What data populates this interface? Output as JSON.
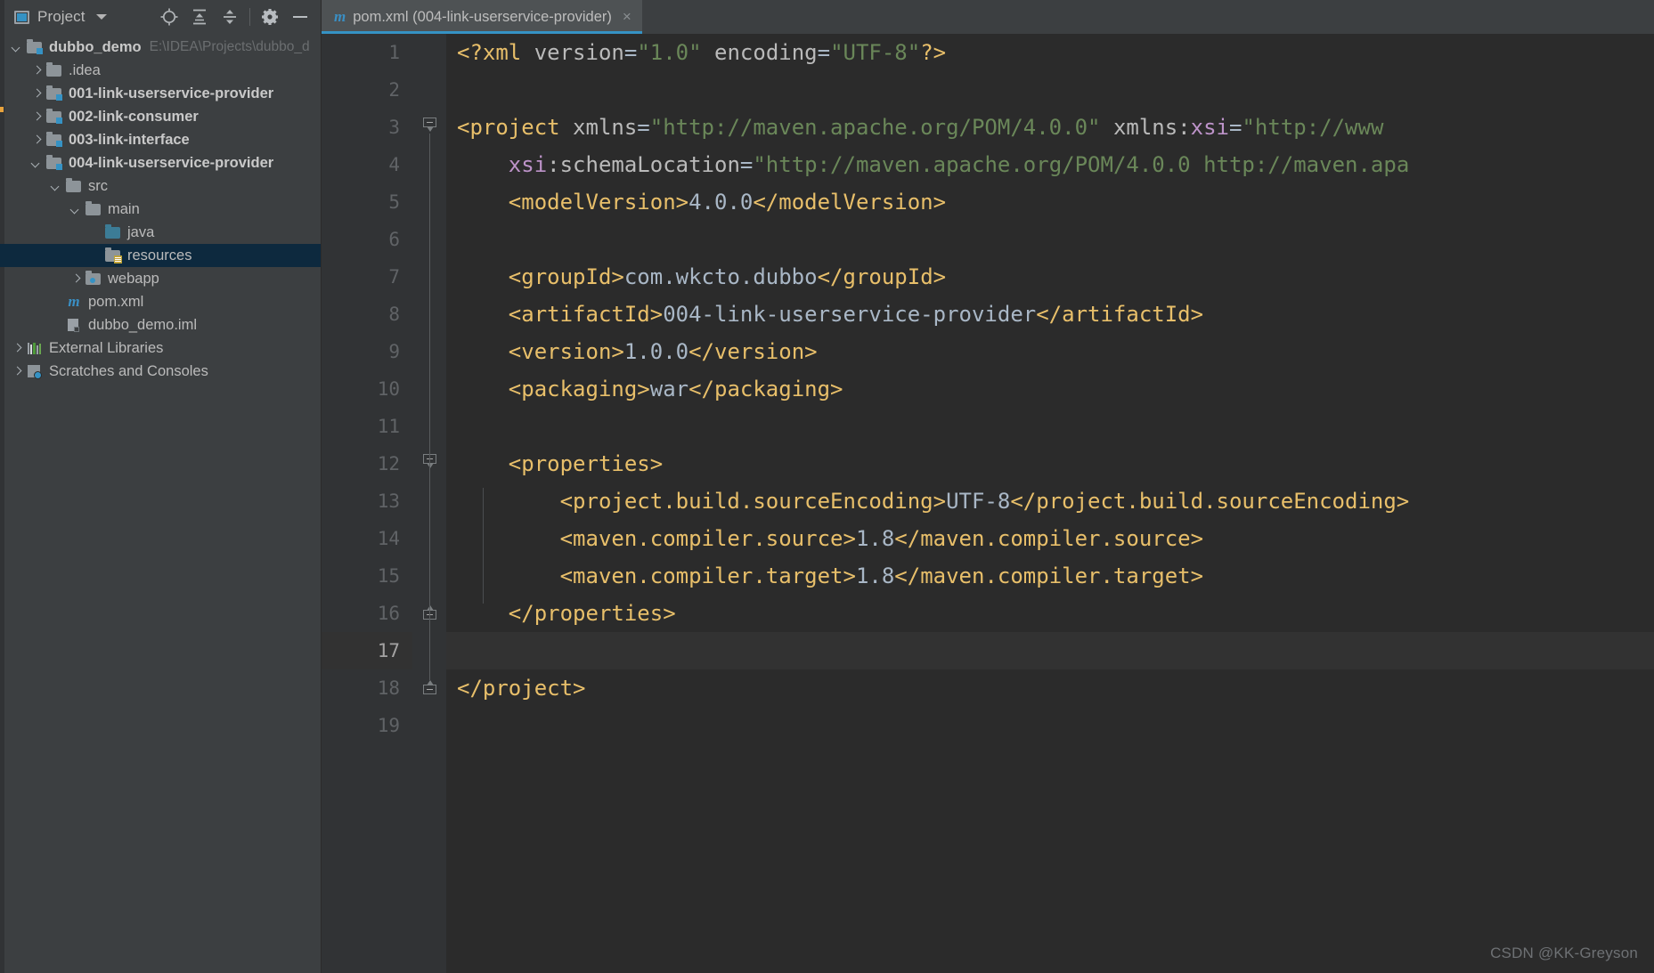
{
  "sidebar": {
    "title": "Project",
    "title_icon": "project-panel-icon",
    "caret_icon": "chevron-down-icon",
    "toolbar_buttons": [
      {
        "name": "locate-icon",
        "tooltip": "Select Opened File"
      },
      {
        "name": "expand-all-icon",
        "tooltip": "Expand All"
      },
      {
        "name": "collapse-all-icon",
        "tooltip": "Collapse All"
      },
      {
        "name": "gear-icon",
        "tooltip": "Settings"
      },
      {
        "name": "minimize-icon",
        "tooltip": "Hide"
      }
    ],
    "tree": [
      {
        "label": "dubbo_demo",
        "sub": "E:\\IDEA\\Projects\\dubbo_d",
        "indent": 0,
        "arrow": "down",
        "icon": "module-folder-icon",
        "bold": true,
        "selected": false
      },
      {
        "label": ".idea",
        "sub": "",
        "indent": 1,
        "arrow": "right",
        "icon": "folder-icon",
        "bold": false,
        "selected": false
      },
      {
        "label": "001-link-userservice-provider",
        "sub": "",
        "indent": 1,
        "arrow": "right",
        "icon": "module-folder-icon",
        "bold": true,
        "selected": false
      },
      {
        "label": "002-link-consumer",
        "sub": "",
        "indent": 1,
        "arrow": "right",
        "icon": "module-folder-icon",
        "bold": true,
        "selected": false
      },
      {
        "label": "003-link-interface",
        "sub": "",
        "indent": 1,
        "arrow": "right",
        "icon": "module-folder-icon",
        "bold": true,
        "selected": false
      },
      {
        "label": "004-link-userservice-provider",
        "sub": "",
        "indent": 1,
        "arrow": "down",
        "icon": "module-folder-icon",
        "bold": true,
        "selected": false
      },
      {
        "label": "src",
        "sub": "",
        "indent": 2,
        "arrow": "down",
        "icon": "folder-icon",
        "bold": false,
        "selected": false
      },
      {
        "label": "main",
        "sub": "",
        "indent": 3,
        "arrow": "down",
        "icon": "folder-icon",
        "bold": false,
        "selected": false
      },
      {
        "label": "java",
        "sub": "",
        "indent": 4,
        "arrow": "none",
        "icon": "source-folder-icon",
        "bold": false,
        "selected": false
      },
      {
        "label": "resources",
        "sub": "",
        "indent": 4,
        "arrow": "none",
        "icon": "resources-folder-icon",
        "bold": false,
        "selected": true
      },
      {
        "label": "webapp",
        "sub": "",
        "indent": 3,
        "arrow": "right",
        "icon": "webapp-folder-icon",
        "bold": false,
        "selected": false
      },
      {
        "label": "pom.xml",
        "sub": "",
        "indent": 2,
        "arrow": "none",
        "icon": "maven-file-icon",
        "bold": false,
        "selected": false
      },
      {
        "label": "dubbo_demo.iml",
        "sub": "",
        "indent": 2,
        "arrow": "none",
        "icon": "iml-file-icon",
        "bold": false,
        "selected": false
      },
      {
        "label": "External Libraries",
        "sub": "",
        "indent": 0,
        "arrow": "right",
        "icon": "libraries-icon",
        "bold": false,
        "selected": false
      },
      {
        "label": "Scratches and Consoles",
        "sub": "",
        "indent": 0,
        "arrow": "right",
        "icon": "scratches-icon",
        "bold": false,
        "selected": false
      }
    ]
  },
  "editor": {
    "tab": {
      "icon": "maven-file-icon",
      "label": "pom.xml (004-link-userservice-provider)",
      "close_label": "×"
    },
    "current_line": 17,
    "total_lines": 19,
    "line_numbers": [
      "1",
      "2",
      "3",
      "4",
      "5",
      "6",
      "7",
      "8",
      "9",
      "10",
      "11",
      "12",
      "13",
      "14",
      "15",
      "16",
      "17",
      "18",
      "19"
    ],
    "folds": [
      {
        "line": 3,
        "type": "open"
      },
      {
        "line": 12,
        "type": "open"
      },
      {
        "line": 16,
        "type": "close"
      },
      {
        "line": 18,
        "type": "close"
      }
    ],
    "lines": [
      {
        "n": 1,
        "tokens": [
          {
            "t": "<?xml ",
            "c": "t-pi"
          },
          {
            "t": "version",
            "c": "t-attr"
          },
          {
            "t": "=",
            "c": "t-eq"
          },
          {
            "t": "\"1.0\"",
            "c": "t-val"
          },
          {
            "t": " ",
            "c": "t-txt"
          },
          {
            "t": "encoding",
            "c": "t-attr"
          },
          {
            "t": "=",
            "c": "t-eq"
          },
          {
            "t": "\"UTF-8\"",
            "c": "t-val"
          },
          {
            "t": "?>",
            "c": "t-pi"
          }
        ]
      },
      {
        "n": 2,
        "tokens": []
      },
      {
        "n": 3,
        "tokens": [
          {
            "t": "<project",
            "c": "t-tag"
          },
          {
            "t": " ",
            "c": "t-txt"
          },
          {
            "t": "xmlns",
            "c": "t-attr"
          },
          {
            "t": "=",
            "c": "t-eq"
          },
          {
            "t": "\"http://maven.apache.org/POM/4.0.0\"",
            "c": "t-val"
          },
          {
            "t": " ",
            "c": "t-txt"
          },
          {
            "t": "xmlns:",
            "c": "t-attr"
          },
          {
            "t": "xsi",
            "c": "t-ns"
          },
          {
            "t": "=",
            "c": "t-eq"
          },
          {
            "t": "\"http://www",
            "c": "t-val"
          }
        ]
      },
      {
        "n": 4,
        "tokens": [
          {
            "t": "    ",
            "c": "t-txt"
          },
          {
            "t": "xsi",
            "c": "t-ns"
          },
          {
            "t": ":schemaLocation",
            "c": "t-attr"
          },
          {
            "t": "=",
            "c": "t-eq"
          },
          {
            "t": "\"http://maven.apache.org/POM/4.0.0 http://maven.apa",
            "c": "t-val"
          }
        ]
      },
      {
        "n": 5,
        "tokens": [
          {
            "t": "    ",
            "c": "t-txt"
          },
          {
            "t": "<modelVersion>",
            "c": "t-tag"
          },
          {
            "t": "4.0.0",
            "c": "t-txt"
          },
          {
            "t": "</modelVersion>",
            "c": "t-tag"
          }
        ]
      },
      {
        "n": 6,
        "tokens": []
      },
      {
        "n": 7,
        "tokens": [
          {
            "t": "    ",
            "c": "t-txt"
          },
          {
            "t": "<groupId>",
            "c": "t-tag"
          },
          {
            "t": "com.wkcto.dubbo",
            "c": "t-txt"
          },
          {
            "t": "</groupId>",
            "c": "t-tag"
          }
        ]
      },
      {
        "n": 8,
        "tokens": [
          {
            "t": "    ",
            "c": "t-txt"
          },
          {
            "t": "<artifactId>",
            "c": "t-tag"
          },
          {
            "t": "004-link-userservice-provider",
            "c": "t-txt"
          },
          {
            "t": "</artifactId>",
            "c": "t-tag"
          }
        ]
      },
      {
        "n": 9,
        "tokens": [
          {
            "t": "    ",
            "c": "t-txt"
          },
          {
            "t": "<version>",
            "c": "t-tag"
          },
          {
            "t": "1.0.0",
            "c": "t-txt"
          },
          {
            "t": "</version>",
            "c": "t-tag"
          }
        ]
      },
      {
        "n": 10,
        "tokens": [
          {
            "t": "    ",
            "c": "t-txt"
          },
          {
            "t": "<packaging>",
            "c": "t-tag"
          },
          {
            "t": "war",
            "c": "t-txt"
          },
          {
            "t": "</packaging>",
            "c": "t-tag"
          }
        ]
      },
      {
        "n": 11,
        "tokens": []
      },
      {
        "n": 12,
        "tokens": [
          {
            "t": "    ",
            "c": "t-txt"
          },
          {
            "t": "<properties>",
            "c": "t-tag"
          }
        ]
      },
      {
        "n": 13,
        "tokens": [
          {
            "t": "        ",
            "c": "t-txt"
          },
          {
            "t": "<project.build.sourceEncoding>",
            "c": "t-tag"
          },
          {
            "t": "UTF-8",
            "c": "t-txt"
          },
          {
            "t": "</project.build.sourceEncoding>",
            "c": "t-tag"
          }
        ]
      },
      {
        "n": 14,
        "tokens": [
          {
            "t": "        ",
            "c": "t-txt"
          },
          {
            "t": "<maven.compiler.source>",
            "c": "t-tag"
          },
          {
            "t": "1.8",
            "c": "t-txt"
          },
          {
            "t": "</maven.compiler.source>",
            "c": "t-tag"
          }
        ]
      },
      {
        "n": 15,
        "tokens": [
          {
            "t": "        ",
            "c": "t-txt"
          },
          {
            "t": "<maven.compiler.target>",
            "c": "t-tag"
          },
          {
            "t": "1.8",
            "c": "t-txt"
          },
          {
            "t": "</maven.compiler.target>",
            "c": "t-tag"
          }
        ]
      },
      {
        "n": 16,
        "tokens": [
          {
            "t": "    ",
            "c": "t-txt"
          },
          {
            "t": "</properties>",
            "c": "t-tag"
          }
        ]
      },
      {
        "n": 17,
        "tokens": []
      },
      {
        "n": 18,
        "tokens": [
          {
            "t": "</project>",
            "c": "t-tag"
          }
        ]
      },
      {
        "n": 19,
        "tokens": []
      }
    ]
  },
  "watermark": "CSDN @KK-Greyson",
  "colors": {
    "sidebar_bg": "#3c3f41",
    "editor_bg": "#2b2b2b",
    "gutter_bg": "#313335",
    "selection_bg": "#0d293e",
    "tab_active_bg": "#4e5254",
    "tab_underline": "#3592c4",
    "current_line_bg": "#323232",
    "tag_color": "#e8bf6a",
    "value_color": "#6a8759",
    "text_color": "#a9b7c6",
    "ns_color": "#bd93c9",
    "accent": "#3592c4"
  }
}
